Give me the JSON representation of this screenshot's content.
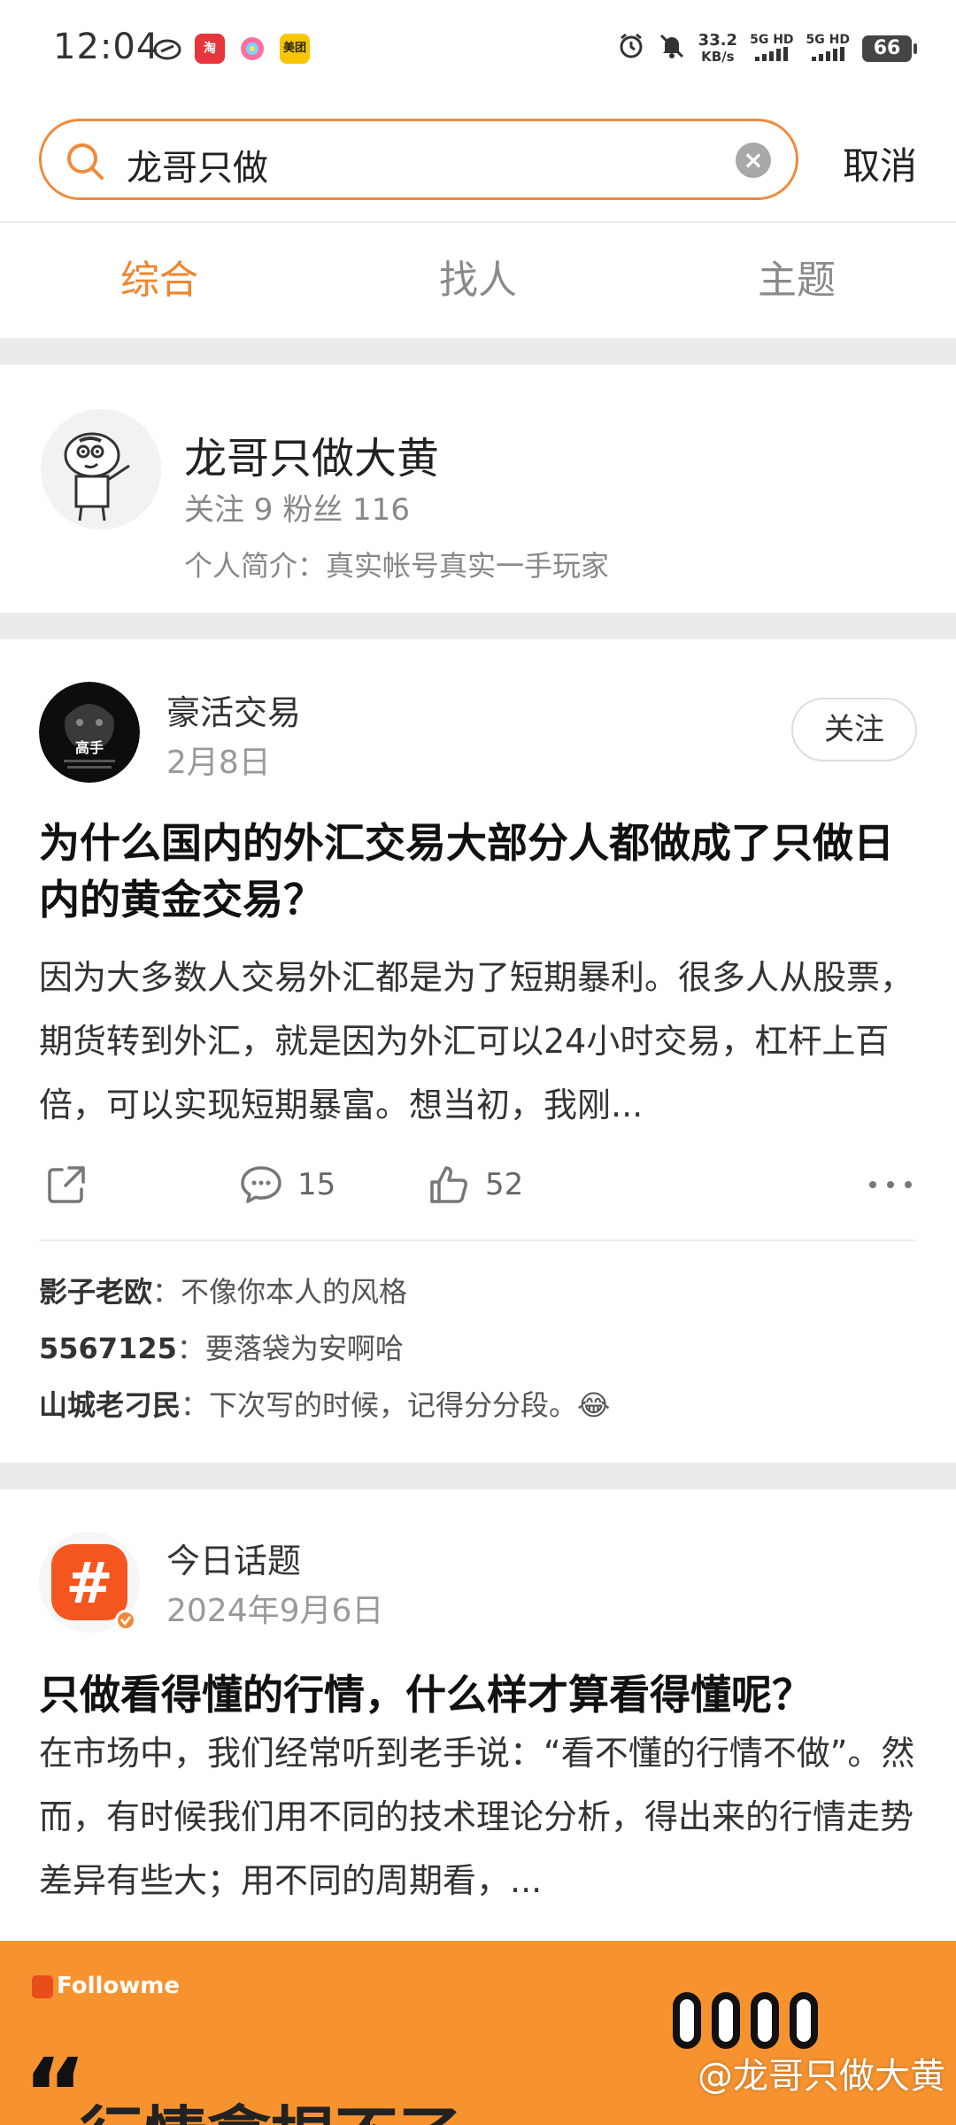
{
  "status_bar": {
    "time": "12:04",
    "speed_value": "33.2",
    "speed_unit": "KB/s",
    "sig1": "5G HD",
    "sig2": "5G HD",
    "battery": "66",
    "app_icons": [
      {
        "name": "weibo-icon",
        "color": "#333333"
      },
      {
        "name": "taobao-icon",
        "label": "淘",
        "color": "#e8343b"
      },
      {
        "name": "photo-app-icon",
        "color": "#ff6fa0"
      },
      {
        "name": "meituan-icon",
        "label": "美团",
        "color": "#f7c600"
      }
    ]
  },
  "search": {
    "query": "龙哥只做",
    "cancel_label": "取消"
  },
  "tabs": [
    {
      "label": "综合",
      "active": true
    },
    {
      "label": "找人",
      "active": false
    },
    {
      "label": "主题",
      "active": false
    }
  ],
  "user_card": {
    "name": "龙哥只做大黄",
    "meta": "关注 9 粉丝 116",
    "bio": "个人简介：真实帐号真实一手玩家"
  },
  "post1": {
    "author": "豪活交易",
    "date": "2月8日",
    "follow_label": "关注",
    "avatar_text": "高手",
    "title": "为什么国内的外汇交易大部分人都做成了只做日内的黄金交易？",
    "body": "因为大多数人交易外汇都是为了短期暴利。很多人从股票，期货转到外汇，就是因为外汇可以24小时交易，杠杆上百倍，可以实现短期暴富。想当初，我刚...",
    "comments_count": "15",
    "likes_count": "52",
    "comments": [
      {
        "user": "影子老欧",
        "text": "：不像你本人的风格"
      },
      {
        "user": "5567125",
        "text": "：要落袋为安啊哈"
      },
      {
        "user": "山城老刁民",
        "text": "：下次写的时候，记得分分段。😂"
      }
    ]
  },
  "post2": {
    "author": "今日话题",
    "date": "2024年9月6日",
    "title": "只做看得懂的行情，什么样才算看得懂呢？",
    "body": "在市场中，我们经常听到老手说：“看不懂的行情不做”。然而，有时候我们用不同的技术理论分析，得出来的行情走势差异有些大；用不同的周期看，..."
  },
  "banner": {
    "logo": "Followme",
    "quote_mark": "“",
    "headline": "行情拿捏不了",
    "watermark": "@龙哥只做大黄"
  },
  "colors": {
    "accent": "#f0852c",
    "search_border": "#f08a3c",
    "banner_bg": "#f7932f",
    "topic_icon": "#f5561f"
  }
}
